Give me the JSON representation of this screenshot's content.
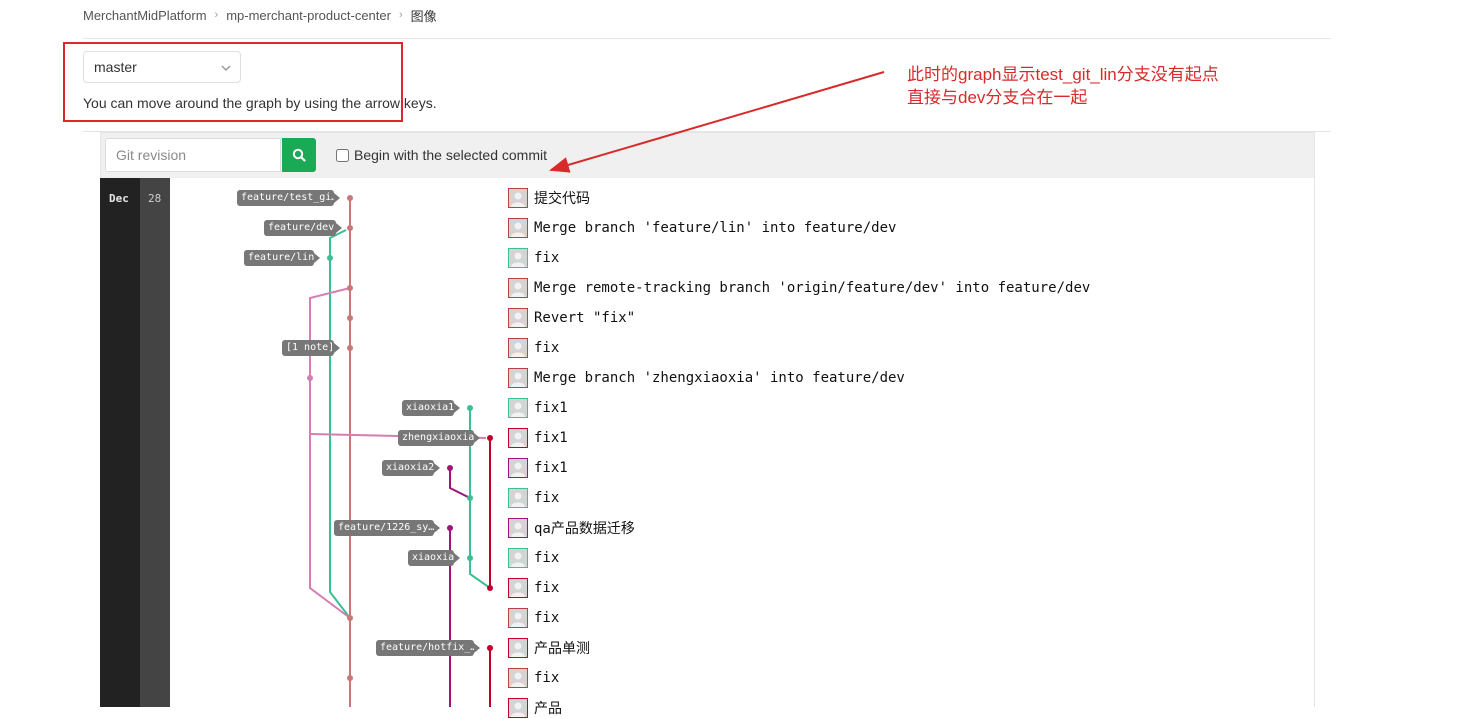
{
  "breadcrumb": {
    "items": [
      "MerchantMidPlatform",
      "mp-merchant-product-center",
      "图像"
    ],
    "separator": "›"
  },
  "branch_select": {
    "value": "master"
  },
  "hint": "You can move around the graph by using the arrow keys.",
  "annotation": {
    "line1": "此时的graph显示test_git_lin分支没有起点",
    "line2": "直接与dev分支合在一起",
    "color": "#d82a2a"
  },
  "toolbar": {
    "revision_placeholder": "Git revision",
    "search_icon": "search-icon",
    "search_button_color": "#1aaa55",
    "begin_label": "Begin with the selected commit",
    "begin_checked": false
  },
  "date": {
    "month": "Dec",
    "day": "28"
  },
  "refs": [
    {
      "label": "feature/test_gi…",
      "row": 0
    },
    {
      "label": "feature/dev",
      "row": 1
    },
    {
      "label": "feature/lin",
      "row": 2
    },
    {
      "label": "[1 note]",
      "row": 5
    },
    {
      "label": "xiaoxia1",
      "row": 7
    },
    {
      "label": "zhengxiaoxia",
      "row": 8
    },
    {
      "label": "xiaoxia2",
      "row": 9
    },
    {
      "label": "feature/1226_sy…",
      "row": 11
    },
    {
      "label": "xiaoxia",
      "row": 12
    },
    {
      "label": "feature/hotfix_…",
      "row": 15
    }
  ],
  "commits": [
    {
      "message": "提交代码",
      "avatar_color": "#b44444"
    },
    {
      "message": "Merge branch 'feature/lin' into feature/dev",
      "avatar_color": "#b44444"
    },
    {
      "message": "fix",
      "avatar_color": "#3cbf94"
    },
    {
      "message": "Merge remote-tracking branch 'origin/feature/dev' into feature/dev",
      "avatar_color": "#b44444"
    },
    {
      "message": "Revert \"fix\"",
      "avatar_color": "#b44444"
    },
    {
      "message": "fix",
      "avatar_color": "#b44444"
    },
    {
      "message": "Merge branch 'zhengxiaoxia' into feature/dev",
      "avatar_color": "#b44444"
    },
    {
      "message": "fix1",
      "avatar_color": "#3cbf94"
    },
    {
      "message": "fix1",
      "avatar_color": "#c0002a"
    },
    {
      "message": "fix1",
      "avatar_color": "#a0147a"
    },
    {
      "message": "fix",
      "avatar_color": "#3cbf94"
    },
    {
      "message": "qa产品数据迁移",
      "avatar_color": "#a0147a"
    },
    {
      "message": "fix",
      "avatar_color": "#3cbf94"
    },
    {
      "message": "fix",
      "avatar_color": "#c0002a"
    },
    {
      "message": "fix",
      "avatar_color": "#b44444"
    },
    {
      "message": "产品单测",
      "avatar_color": "#c0002a"
    },
    {
      "message": "fix",
      "avatar_color": "#b44444"
    },
    {
      "message": "产品",
      "avatar_color": "#c0002a"
    }
  ],
  "lane_colors": {
    "dev": "#c87878",
    "pink": "#d47eb4",
    "teal": "#3cbf94",
    "crimson": "#c0002a",
    "magenta": "#a0147a"
  }
}
